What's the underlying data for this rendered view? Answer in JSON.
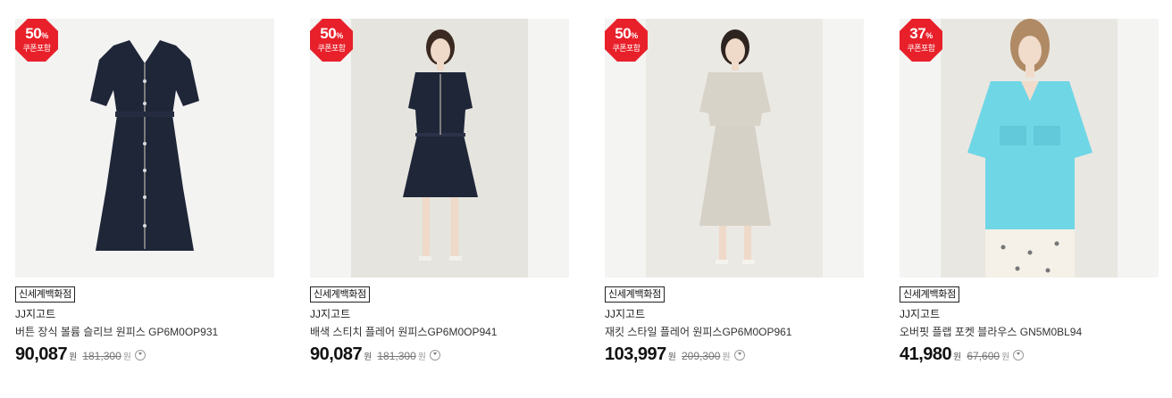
{
  "products": [
    {
      "badge": {
        "percent": "50",
        "percent_sign": "%",
        "label": "쿠폰포함"
      },
      "store": "신세계백화점",
      "brand": "JJ지고트",
      "name": "버튼 장식 볼륨 슬리브 원피스 GP6M0OP931",
      "sale_price": "90,087",
      "original_price": "181,300",
      "currency": "원",
      "image_icon": "navy-dress-icon"
    },
    {
      "badge": {
        "percent": "50",
        "percent_sign": "%",
        "label": "쿠폰포함"
      },
      "store": "신세계백화점",
      "brand": "JJ지고트",
      "name": "배색 스티치 플레어 원피스GP6M0OP941",
      "sale_price": "90,087",
      "original_price": "181,300",
      "currency": "원",
      "image_icon": "navy-dress-model-icon"
    },
    {
      "badge": {
        "percent": "50",
        "percent_sign": "%",
        "label": "쿠폰포함"
      },
      "store": "신세계백화점",
      "brand": "JJ지고트",
      "name": "재킷 스타일 플레어 원피스GP6M0OP961",
      "sale_price": "103,997",
      "original_price": "209,300",
      "currency": "원",
      "image_icon": "beige-dress-model-icon"
    },
    {
      "badge": {
        "percent": "37",
        "percent_sign": "%",
        "label": "쿠폰포함"
      },
      "store": "신세계백화점",
      "brand": "JJ지고트",
      "name": "오버핏 플랩 포켓 블라우스 GN5M0BL94",
      "sale_price": "41,980",
      "original_price": "67,600",
      "currency": "원",
      "image_icon": "blue-blouse-model-icon"
    }
  ],
  "colors": {
    "badge": "#e8202a",
    "navy": "#1f2638",
    "beige": "#d8d3c8",
    "sky_blue": "#6fd6e6"
  }
}
